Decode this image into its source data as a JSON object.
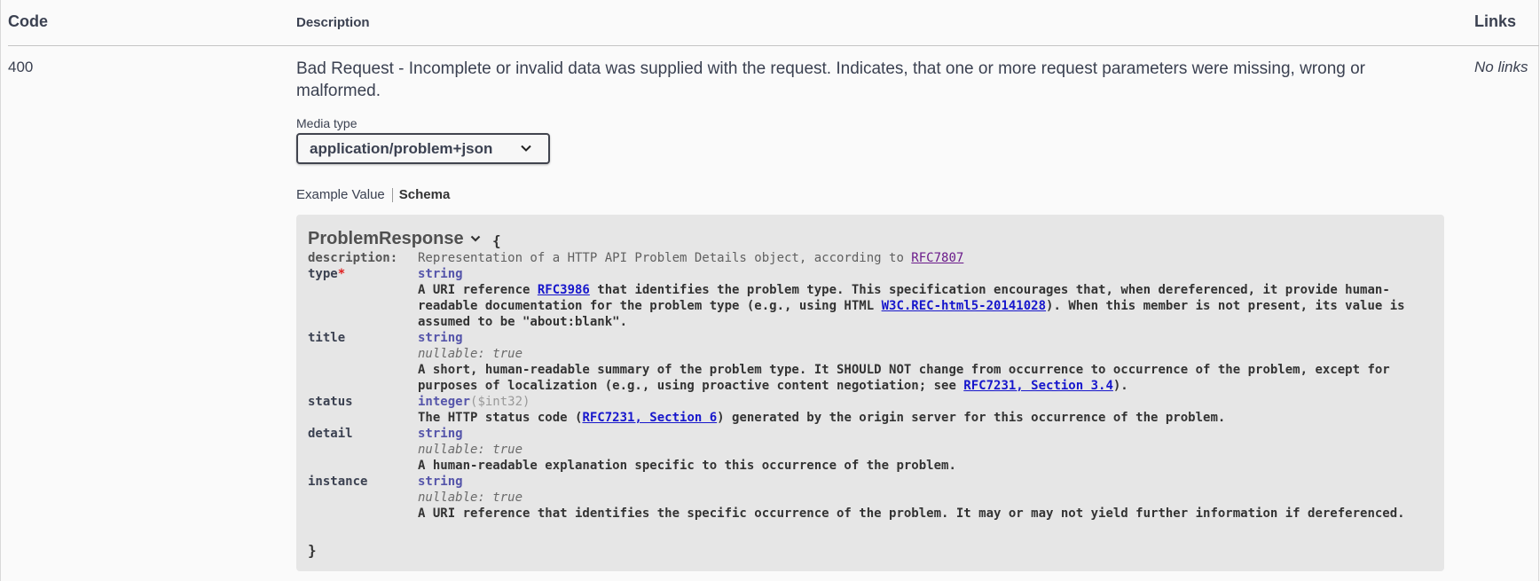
{
  "table": {
    "header_code": "Code",
    "header_description": "Description",
    "header_links": "Links"
  },
  "response": {
    "code": "400",
    "description": "Bad Request - Incomplete or invalid data was supplied with the request. Indicates, that one or more request parameters were missing, wrong or malformed.",
    "links": "No links",
    "media_type_label": "Media type",
    "media_type_value": "application/problem+json",
    "tabs": {
      "example_value": "Example Value",
      "schema": "Schema"
    }
  },
  "schema": {
    "model_name": "ProblemResponse",
    "open_brace": "{",
    "close_brace": "}",
    "description_key": "description:",
    "description_text": "Representation of a HTTP API Problem Details object, according to ",
    "description_link": "RFC7807",
    "properties": {
      "type": {
        "name": "type",
        "required_mark": "*",
        "type": "string",
        "desc_1": "A URI reference ",
        "link_1": "RFC3986",
        "desc_2": " that identifies the problem type. This specification encourages that, when dereferenced, it provide human-readable documentation for the problem type (e.g., using HTML ",
        "link_2": "W3C.REC-html5-20141028",
        "desc_3": "). When this member is not present, its value is assumed to be \"about:blank\"."
      },
      "title": {
        "name": "title",
        "type": "string",
        "nullable": "nullable: true",
        "desc_1": "A short, human-readable summary of the problem type. It SHOULD NOT change from occurrence to occurrence of the problem, except for purposes of localization (e.g., using proactive content negotiation; see ",
        "link_1": "RFC7231, Section 3.4",
        "desc_2": ")."
      },
      "status": {
        "name": "status",
        "type": "integer",
        "format": "($int32)",
        "desc_1": "The HTTP status code (",
        "link_1": "RFC7231, Section 6",
        "desc_2": ") generated by the origin server for this occurrence of the problem."
      },
      "detail": {
        "name": "detail",
        "type": "string",
        "nullable": "nullable: true",
        "desc": "A human-readable explanation specific to this occurrence of the problem."
      },
      "instance": {
        "name": "instance",
        "type": "string",
        "nullable": "nullable: true",
        "desc": "A URI reference that identifies the specific occurrence of the problem. It may or may not yield further information if dereferenced."
      }
    }
  },
  "icons": {
    "model_toggle": "chevron-down-icon",
    "select_arrow": "chevron-down-icon"
  },
  "colors": {
    "background": "#fafafa",
    "schema_bg": "#e6e6e6",
    "type": "#5555aa",
    "link": "#1717cc",
    "required": "#e02020"
  }
}
